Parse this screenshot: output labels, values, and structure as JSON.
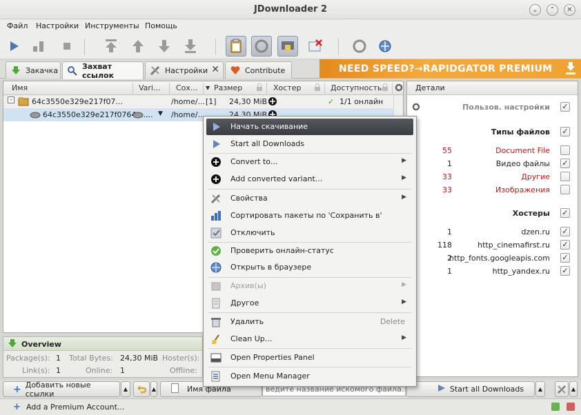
{
  "window": {
    "title": "JDownloader 2"
  },
  "menubar": [
    "Файл",
    "Настройки",
    "Инструменты",
    "Помощь"
  ],
  "tabs": [
    {
      "label": "Закачка"
    },
    {
      "label": "Захват ссылок"
    },
    {
      "label": "Настройки"
    },
    {
      "label": "Contribute"
    }
  ],
  "banner": "NEED SPEED?→RAPIDGATOR PREMIUM",
  "table": {
    "columns": [
      "Имя",
      "Vari...",
      "Сох...",
      "Размер",
      "Хостер",
      "Доступность"
    ],
    "package_row": {
      "name": "64c3550e329e217f07...",
      "save": "/home/...",
      "count": "[1]",
      "size": "24,30 MiB",
      "availability": "1/1 онлайн"
    },
    "file_row": {
      "name": "64c3550e329e217f0764a...",
      "variant": "...",
      "save": "/home/...",
      "size": "24,30 MiB"
    }
  },
  "overview": {
    "title": "Overview",
    "labels": {
      "packages": "Package(s):",
      "total_bytes": "Total Bytes:",
      "hosters": "Hoster(s):",
      "links": "Link(s):",
      "online": "Online:",
      "offline": "Offline:"
    },
    "values": {
      "packages": "1",
      "total_bytes": "24,30 MiB",
      "links": "1",
      "online": "1"
    }
  },
  "details": {
    "title": "Детали",
    "user_settings": "Пользов. настройки",
    "filetypes_title": "Типы файлов",
    "filetypes": [
      {
        "count": "55",
        "label": "Document File",
        "red": true,
        "checked": false
      },
      {
        "count": "1",
        "label": "Видео файлы",
        "red": false,
        "checked": true
      },
      {
        "count": "33",
        "label": "Другие",
        "red": true,
        "checked": false
      },
      {
        "count": "33",
        "label": "Изображения",
        "red": true,
        "checked": false
      }
    ],
    "hosters_title": "Хостеры",
    "hosters": [
      {
        "count": "1",
        "label": "dzen.ru"
      },
      {
        "count": "118",
        "label": "http_cinemafirst.ru"
      },
      {
        "count": "2",
        "label": "http_fonts.googleapis.com"
      },
      {
        "count": "1",
        "label": "http_yandex.ru"
      }
    ]
  },
  "bottom": {
    "add_links": "Добавить новые ссылки",
    "filename_field": "Имя файла",
    "search_placeholder": "ведите название искомого файла...",
    "start_all": "Start all Downloads"
  },
  "status": {
    "add_premium": "Add a Premium Account..."
  },
  "context_menu": [
    {
      "label": "Начать скачивание",
      "selected": true
    },
    {
      "label": "Start all Downloads"
    },
    {
      "sep": true
    },
    {
      "label": "Convert to...",
      "submenu": true
    },
    {
      "label": "Add converted variant...",
      "submenu": true
    },
    {
      "sep": true
    },
    {
      "label": "Свойства",
      "submenu": true
    },
    {
      "label": "Сортировать пакеты по 'Сохранить в'"
    },
    {
      "label": "Отключить"
    },
    {
      "sep": true
    },
    {
      "label": "Проверить онлайн-статус"
    },
    {
      "label": "Открыть в браузере"
    },
    {
      "sep": true
    },
    {
      "label": "Архив(ы)",
      "submenu": true,
      "disabled": true
    },
    {
      "label": "Другое",
      "submenu": true
    },
    {
      "sep": true
    },
    {
      "label": "Удалить",
      "shortcut": "Delete"
    },
    {
      "label": "Clean Up...",
      "submenu": true
    },
    {
      "sep": true
    },
    {
      "label": "Open Properties Panel"
    },
    {
      "sep": true
    },
    {
      "label": "Open Menu Manager"
    }
  ]
}
